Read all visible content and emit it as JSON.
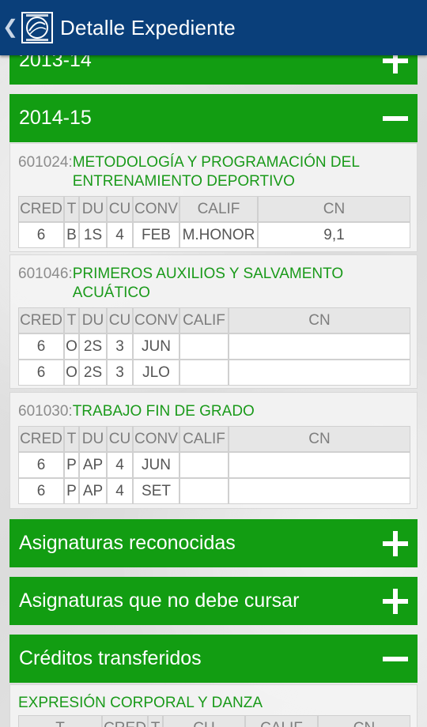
{
  "appbar": {
    "back_glyph": "❮",
    "logo_name": "university-logo",
    "title": "Detalle Expediente"
  },
  "sections": {
    "year_2013": {
      "label": "2013-14",
      "toggle": "plus"
    },
    "year_2014": {
      "label": "2014-15",
      "toggle": "minus"
    },
    "reconocidas": {
      "label": "Asignaturas reconocidas",
      "toggle": "plus"
    },
    "no_cursar": {
      "label": "Asignaturas que no debe cursar",
      "toggle": "plus"
    },
    "transferidos": {
      "label": "Créditos transferidos",
      "toggle": "minus"
    }
  },
  "table_headers": [
    "CRED",
    "T",
    "DU",
    "CU",
    "CONV",
    "CALIF",
    "CN"
  ],
  "courses": [
    {
      "code": "601024:",
      "name": "METODOLOGÍA Y PROGRAMACIÓN DEL ENTRENAMIENTO DEPORTIVO",
      "rows": [
        [
          "6",
          "B",
          "1S",
          "4",
          "FEB",
          "M.HONOR",
          "9,1"
        ]
      ]
    },
    {
      "code": "601046:",
      "name": "PRIMEROS AUXILIOS Y SALVAMENTO ACUÁTICO",
      "rows": [
        [
          "6",
          "O",
          "2S",
          "3",
          "JUN",
          "",
          ""
        ],
        [
          "6",
          "O",
          "2S",
          "3",
          "JLO",
          "",
          ""
        ]
      ]
    },
    {
      "code": "601030:",
      "name": "TRABAJO FIN DE GRADO",
      "rows": [
        [
          "6",
          "P",
          "AP",
          "4",
          "JUN",
          "",
          ""
        ],
        [
          "6",
          "P",
          "AP",
          "4",
          "SET",
          "",
          ""
        ]
      ]
    }
  ],
  "transferred": {
    "title": "EXPRESIÓN CORPORAL Y DANZA",
    "headers": [
      "T",
      "CRED",
      "T",
      "CU",
      "CALIF",
      "CN"
    ]
  },
  "colors": {
    "appbar": "#0a3f7a",
    "section_green": "#129d12",
    "course_title_green": "#1a9a1a"
  }
}
